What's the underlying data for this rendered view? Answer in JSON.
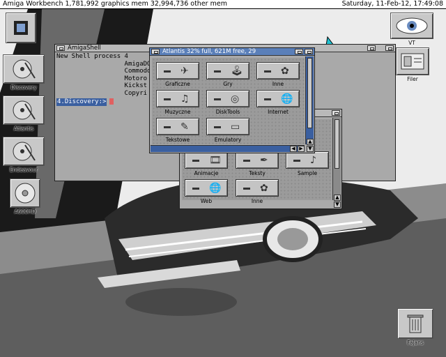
{
  "screen_bar": {
    "left_text": "Amiga Workbench  1,781,992 graphics mem  32,994,736 other mem",
    "right_text": "Saturday, 11-Feb-12, 17:49:08"
  },
  "desktop_icons": {
    "left": [
      {
        "label": "Discovery"
      },
      {
        "label": "Atlantis"
      },
      {
        "label": "Endeavour"
      },
      {
        "label": "A600HD"
      }
    ],
    "right": [
      {
        "label": "VT"
      },
      {
        "label": "Filer"
      },
      {
        "label": "Fajans"
      }
    ]
  },
  "shell": {
    "title": "AmigaShell",
    "lines": [
      "New Shell process 4",
      "",
      "",
      "                  AmigaDO",
      "                  Commodo",
      "                  Motoro                  Fast RAM",
      "                  Kickst                  42",
      "                  Copyri"
    ],
    "prompt": "4.Discovery:>"
  },
  "atlantis": {
    "title": "Atlantis  32% full, 621M free, 29",
    "items": [
      {
        "label": "Graficzne",
        "glyph": "✈"
      },
      {
        "label": "Gry",
        "glyph": "🕹"
      },
      {
        "label": "Inne",
        "glyph": "✿"
      },
      {
        "label": "Muzyczne",
        "glyph": "♫"
      },
      {
        "label": "DiskTools",
        "glyph": "◎"
      },
      {
        "label": "Internet",
        "glyph": "🌐"
      },
      {
        "label": "Tekstowe",
        "glyph": "✎"
      },
      {
        "label": "Emulatory",
        "glyph": "▭"
      }
    ]
  },
  "back_drawer": {
    "items": [
      {
        "label": "Animacje",
        "glyph": "🎞"
      },
      {
        "label": "Teksty",
        "glyph": "✒"
      },
      {
        "label": "Sample",
        "glyph": "♪"
      },
      {
        "label": "Web",
        "glyph": "🌐"
      },
      {
        "label": "Inne",
        "glyph": "✿"
      }
    ]
  }
}
